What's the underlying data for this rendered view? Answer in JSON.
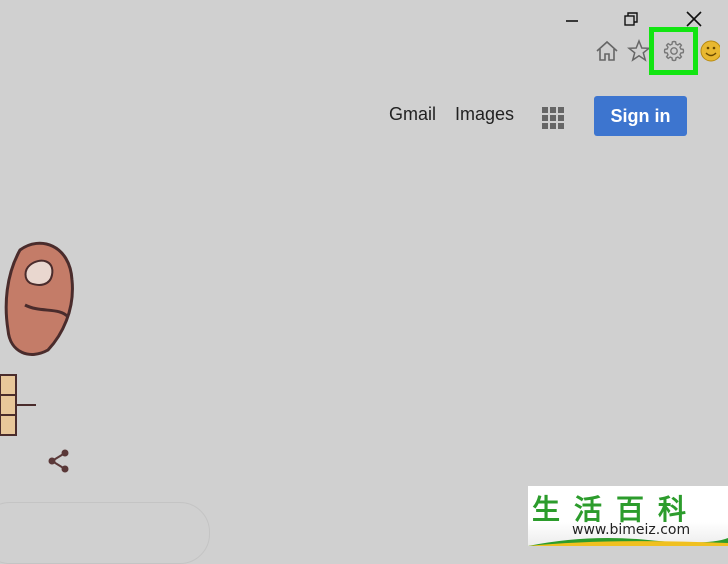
{
  "window_controls": {
    "minimize": "minimize-icon",
    "restore": "restore-icon",
    "close": "close-icon"
  },
  "toolbar": {
    "home": "home-icon",
    "favorites": "star-icon",
    "settings": "gear-icon",
    "feedback": "smiley-icon"
  },
  "header": {
    "gmail_label": "Gmail",
    "images_label": "Images",
    "apps": "apps-grid-icon",
    "signin_label": "Sign in"
  },
  "doodle": {
    "share": "share-icon"
  },
  "watermark": {
    "chars": "生活百科",
    "url": "www.bimeiz.com"
  },
  "colors": {
    "background": "#d0d0d0",
    "signin": "#3d75cf",
    "highlight": "#12e512",
    "doodle": "#c47c68"
  }
}
